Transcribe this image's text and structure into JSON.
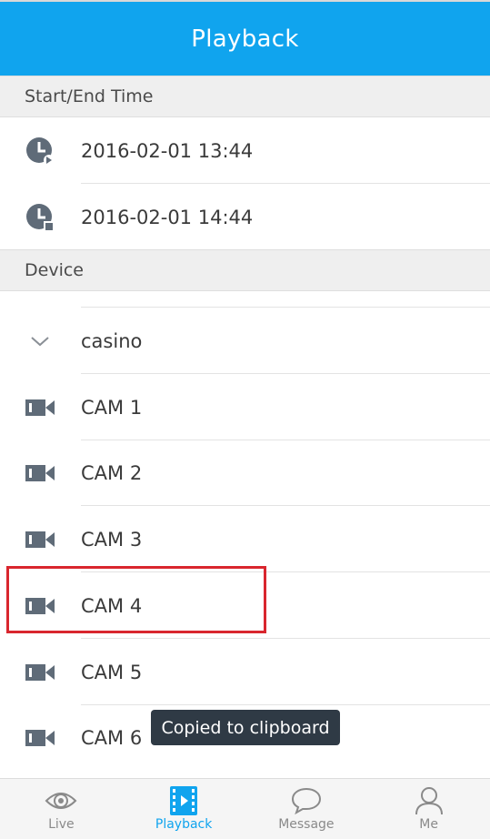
{
  "header": {
    "title": "Playback"
  },
  "sections": {
    "time": "Start/End Time",
    "device": "Device"
  },
  "times": {
    "start": "2016-02-01 13:44",
    "end": "2016-02-01 14:44"
  },
  "device_group": {
    "name": "casino",
    "icon": "chevron-down-icon"
  },
  "cameras": [
    {
      "label": "CAM 1"
    },
    {
      "label": "CAM 2"
    },
    {
      "label": "CAM 3"
    },
    {
      "label": "CAM 4",
      "selected": true
    },
    {
      "label": "CAM 5"
    },
    {
      "label": "CAM 6"
    }
  ],
  "toast": {
    "text": "Copied to clipboard"
  },
  "tabs": [
    {
      "label": "Live",
      "icon": "eye-icon",
      "active": false
    },
    {
      "label": "Playback",
      "icon": "film-play-icon",
      "active": true
    },
    {
      "label": "Message",
      "icon": "chat-bubble-icon",
      "active": false
    },
    {
      "label": "Me",
      "icon": "user-icon",
      "active": false
    }
  ],
  "colors": {
    "accent": "#10a4ee",
    "highlight": "#d9262e",
    "icon": "#5f6b78",
    "toast_bg": "#2f3a45"
  }
}
